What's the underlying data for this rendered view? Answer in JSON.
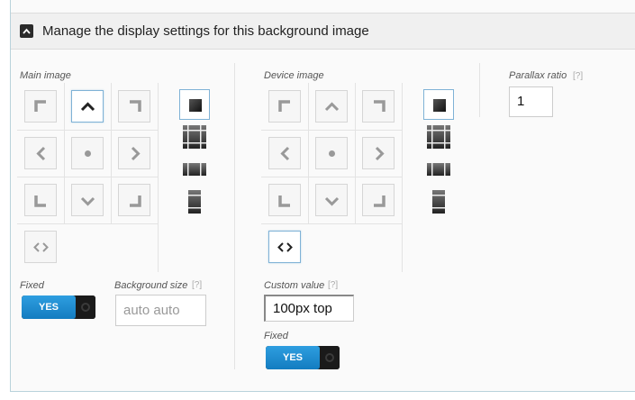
{
  "header": {
    "title": "Manage the display settings for this background image",
    "icon": "chevron-up-icon"
  },
  "main_image": {
    "label": "Main image",
    "position_buttons": [
      {
        "icon": "top-left-corner-icon",
        "active": false
      },
      {
        "icon": "chevron-up-icon",
        "active": true
      },
      {
        "icon": "top-right-corner-icon",
        "active": false
      },
      {
        "icon": "chevron-left-icon",
        "active": false
      },
      {
        "icon": "center-dot-icon",
        "active": false
      },
      {
        "icon": "chevron-right-icon",
        "active": false
      },
      {
        "icon": "bottom-left-corner-icon",
        "active": false
      },
      {
        "icon": "chevron-down-icon",
        "active": false
      },
      {
        "icon": "bottom-right-corner-icon",
        "active": false
      },
      {
        "icon": "code-brackets-icon",
        "active": false
      }
    ],
    "size_buttons": [
      {
        "icon": "size-auto-icon",
        "active": true
      },
      {
        "icon": "size-cover-icon",
        "active": false
      },
      {
        "icon": "size-stretch-horizontal-icon",
        "active": false
      },
      {
        "icon": "size-stretch-vertical-icon",
        "active": false
      }
    ],
    "fixed_label": "Fixed",
    "fixed_toggle": "YES",
    "background_size_label": "Background size",
    "background_size_help": "[?]",
    "background_size_placeholder": "auto auto"
  },
  "device_image": {
    "label": "Device image",
    "position_buttons": [
      {
        "icon": "top-left-corner-icon",
        "active": false
      },
      {
        "icon": "chevron-up-icon",
        "active": false
      },
      {
        "icon": "top-right-corner-icon",
        "active": false
      },
      {
        "icon": "chevron-left-icon",
        "active": false
      },
      {
        "icon": "center-dot-icon",
        "active": false
      },
      {
        "icon": "chevron-right-icon",
        "active": false
      },
      {
        "icon": "bottom-left-corner-icon",
        "active": false
      },
      {
        "icon": "chevron-down-icon",
        "active": false
      },
      {
        "icon": "bottom-right-corner-icon",
        "active": false
      },
      {
        "icon": "code-brackets-icon",
        "active": true
      }
    ],
    "size_buttons": [
      {
        "icon": "size-auto-icon",
        "active": true
      },
      {
        "icon": "size-cover-icon",
        "active": false
      },
      {
        "icon": "size-stretch-horizontal-icon",
        "active": false
      },
      {
        "icon": "size-stretch-vertical-icon",
        "active": false
      }
    ],
    "custom_value_label": "Custom value",
    "custom_value_help": "[?]",
    "custom_value": "100px top",
    "fixed_label": "Fixed",
    "fixed_toggle": "YES"
  },
  "parallax": {
    "label": "Parallax ratio",
    "help": "[?]",
    "value": "1"
  },
  "colors": {
    "accent": "#1f8dd6",
    "active_border": "#7fb2d6"
  }
}
